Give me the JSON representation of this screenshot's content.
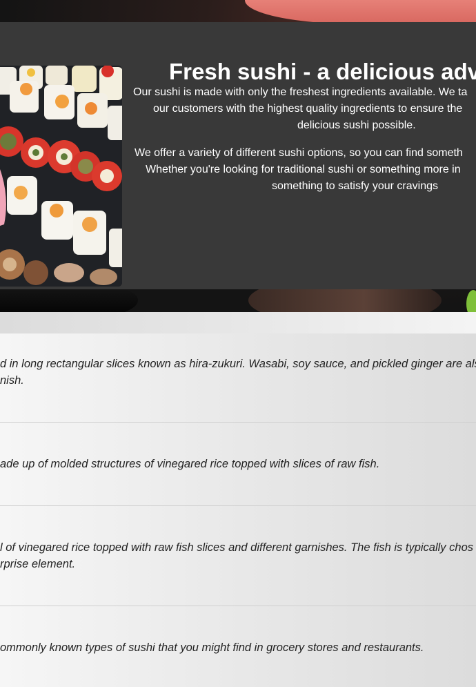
{
  "hero": {
    "title": "Fresh sushi - a delicious adve",
    "paragraph1": {
      "line1": "Our sushi is made with only the freshest ingredients available. We ta",
      "line2": "our customers with the highest quality ingredients to ensure the",
      "line3": "delicious sushi possible."
    },
    "paragraph2": {
      "line1": "We offer a variety of different sushi options, so you can find someth",
      "line2": "Whether you're looking for traditional sushi or something more in",
      "line3": "something to satisfy your cravings"
    }
  },
  "sushi_types": [
    {
      "line1": "d in long rectangular slices known as hira-zukuri. Wasabi, soy sauce, and pickled ginger are als",
      "line2": "nish."
    },
    {
      "line1": "ade up of molded structures of vinegared rice topped with slices of raw fish."
    },
    {
      "line1": "l of vinegared rice topped with raw fish slices and different garnishes. The fish is typically chos",
      "line2": "rprise element."
    },
    {
      "line1": "ommonly known types of sushi that you might find in grocery stores and restaurants."
    }
  ],
  "colors": {
    "card_bg": "#393939",
    "text_light": "#ffffff",
    "text_dark": "#222222"
  }
}
